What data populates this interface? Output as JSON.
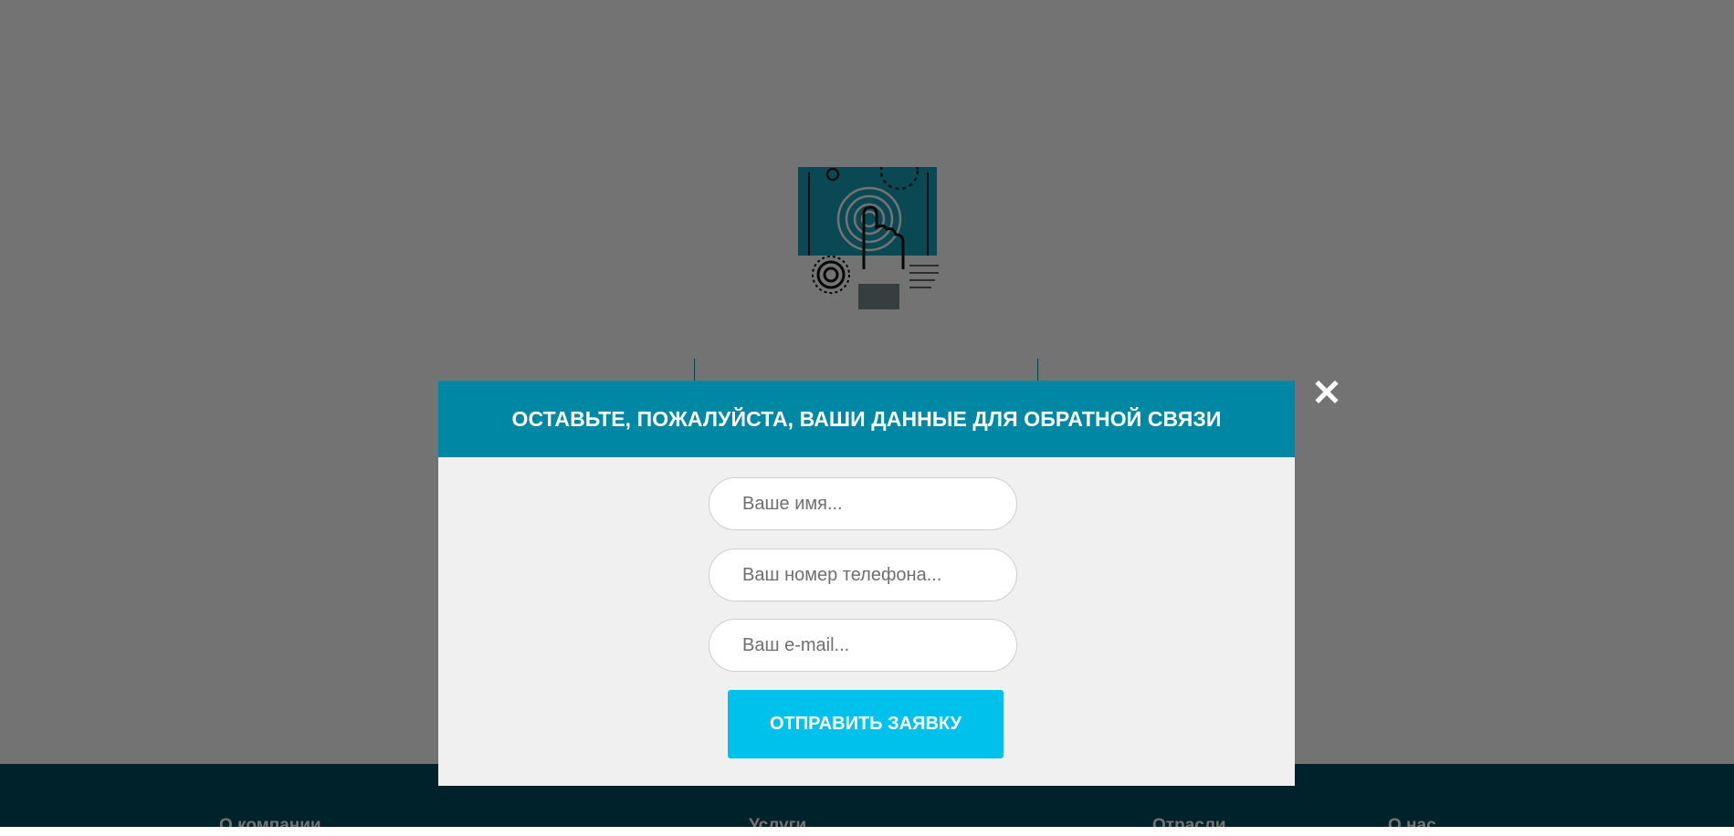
{
  "modal": {
    "title": "ОСТАВЬТЕ, ПОЖАЛУЙСТА, ВАШИ ДАННЫЕ ДЛЯ ОБРАТНОЙ СВЯЗИ",
    "close_icon": "close-icon",
    "name_placeholder": "Ваше имя...",
    "phone_placeholder": "Ваш номер телефона...",
    "email_placeholder": "Ваш e-mail...",
    "submit_label": "ОТПРАВИТЬ ЗАЯВКУ"
  },
  "footer": {
    "links": [
      "О компании",
      "Услуги",
      "Отрасли",
      "О нас"
    ]
  },
  "colors": {
    "modal_header": "#0087a4",
    "submit_button": "#00c0ec",
    "footer": "#004d5e"
  },
  "illustration_icon": "touch-finger-icon"
}
